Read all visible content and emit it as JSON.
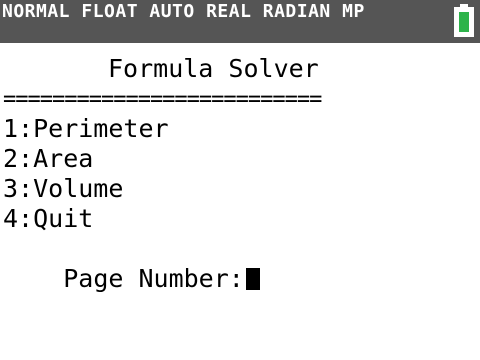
{
  "status_bar": {
    "text": "NORMAL FLOAT AUTO REAL RADIAN MP",
    "battery_icon": "battery-icon",
    "battery_color": "#2db34a"
  },
  "program": {
    "title": "Formula Solver",
    "separator": "==========================",
    "menu": [
      "1:Perimeter",
      "2:Area",
      "3:Volume",
      "4:Quit"
    ],
    "prompt": "Page Number:"
  }
}
